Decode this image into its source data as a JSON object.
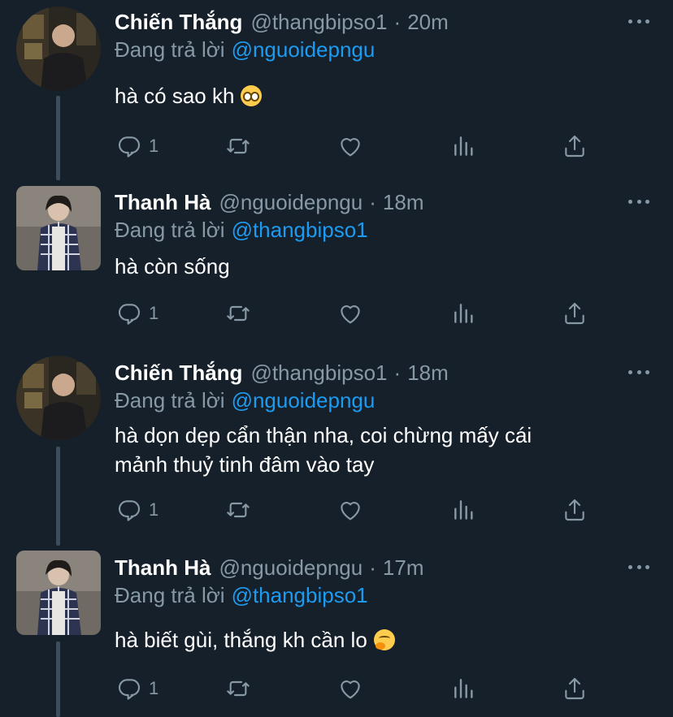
{
  "tweets": [
    {
      "author_name": "Chiến Thắng",
      "handle": "@thangbipso1",
      "separator": "·",
      "time": "20m",
      "reply_label": "Đang trả lời",
      "reply_to": "@nguoidepngu",
      "text_lines": [
        "hà có sao kh"
      ],
      "emoji": "pleading-face",
      "reply_count": "1",
      "avatar": "round"
    },
    {
      "author_name": "Thanh Hà",
      "handle": "@nguoidepngu",
      "separator": "·",
      "time": "18m",
      "reply_label": "Đang trả lời",
      "reply_to": "@thangbipso1",
      "text_lines": [
        "hà còn sống"
      ],
      "emoji": "",
      "reply_count": "1",
      "avatar": "square"
    },
    {
      "author_name": "Chiến Thắng",
      "handle": "@thangbipso1",
      "separator": "·",
      "time": "18m",
      "reply_label": "Đang trả lời",
      "reply_to": "@nguoidepngu",
      "text_lines": [
        "hà dọn dẹp cẩn thận nha, coi chừng mấy cái",
        "mảnh thuỷ tinh đâm vào tay"
      ],
      "emoji": "",
      "reply_count": "1",
      "avatar": "round"
    },
    {
      "author_name": "Thanh Hà",
      "handle": "@nguoidepngu",
      "separator": "·",
      "time": "17m",
      "reply_label": "Đang trả lời",
      "reply_to": "@thangbipso1",
      "text_lines": [
        "hà biết gùi, thắng kh cần lo"
      ],
      "emoji": "face-with-hand-over-mouth",
      "reply_count": "1",
      "avatar": "square"
    }
  ],
  "icons": {
    "reply": "reply-icon",
    "retweet": "retweet-icon",
    "like": "heart-icon",
    "stats": "analytics-icon",
    "share": "share-icon",
    "more": "more-icon"
  },
  "colors": {
    "background": "#15202b",
    "text": "#ffffff",
    "secondary": "#8899a6",
    "link": "#1d9bf0",
    "thread_line": "#3d4d5c"
  }
}
